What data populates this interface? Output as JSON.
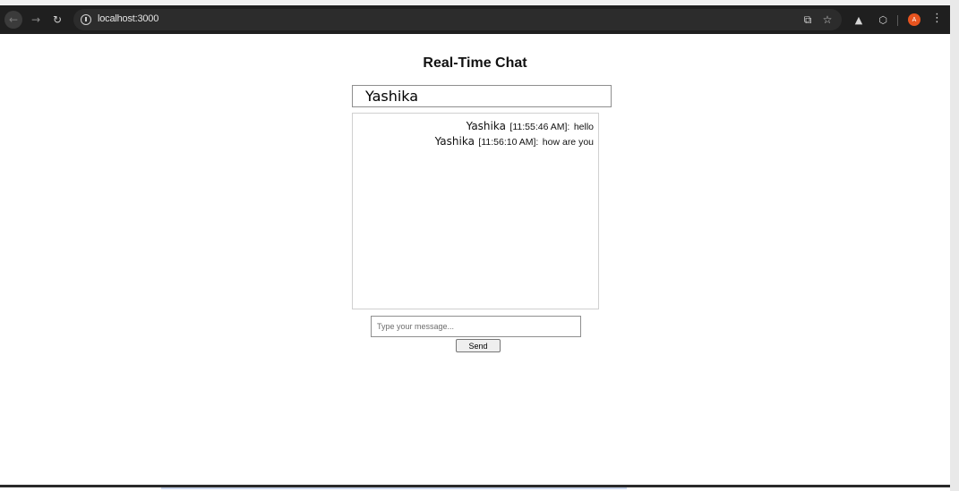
{
  "browser": {
    "url": "localhost:3000",
    "profile_initial": "A",
    "icons": {
      "back": "arrow-left-icon",
      "forward": "arrow-right-icon",
      "reload": "reload-icon",
      "site_info": "info-icon",
      "install": "install-app-icon",
      "bookmark": "star-icon",
      "extension_1": "extension-icon",
      "extension_2": "puzzle-icon",
      "menu": "more-vert-icon"
    },
    "colors": {
      "chrome_bg": "#1f1f1f",
      "avatar": "#e8541f"
    }
  },
  "app": {
    "title": "Real-Time Chat",
    "username_value": "Yashika",
    "messages": [
      {
        "user": "Yashika",
        "time": "[11:55:46 AM]:",
        "text": "hello"
      },
      {
        "user": "Yashika",
        "time": "[11:56:10 AM]:",
        "text": "how are you"
      }
    ],
    "message_placeholder": "Type your message...",
    "send_label": "Send"
  }
}
